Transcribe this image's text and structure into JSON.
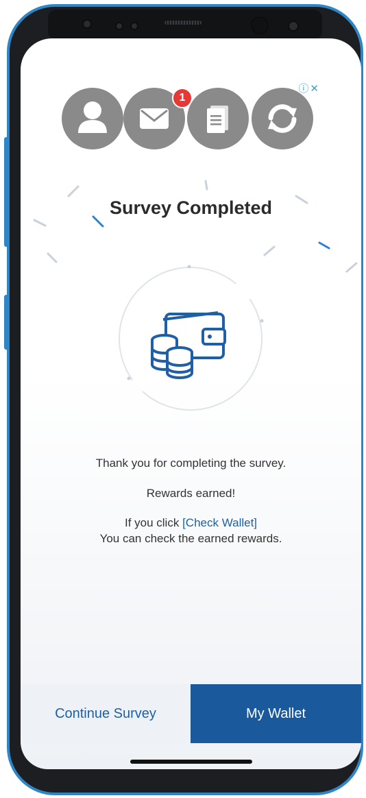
{
  "ad": {
    "badge_text": "ⓘ✕"
  },
  "toolbar": {
    "icons": [
      "profile-icon",
      "mail-icon",
      "document-icon",
      "refresh-icon"
    ],
    "mail_badge_count": "1"
  },
  "main": {
    "title": "Survey Completed",
    "illustration": "wallet-coins-icon",
    "thank_you": "Thank you for completing the survey.",
    "rewards": "Rewards earned!",
    "click_prefix": "If you click ",
    "click_link": "[Check Wallet]",
    "check_text": "You can check the earned rewards."
  },
  "footer": {
    "continue_label": "Continue Survey",
    "wallet_label": "My Wallet"
  },
  "colors": {
    "accent": "#1a5a9c",
    "link": "#1f5fa6",
    "phone_frame": "#2f86c6",
    "badge_red": "#e53935",
    "icon_gray": "#8a8a8a"
  }
}
